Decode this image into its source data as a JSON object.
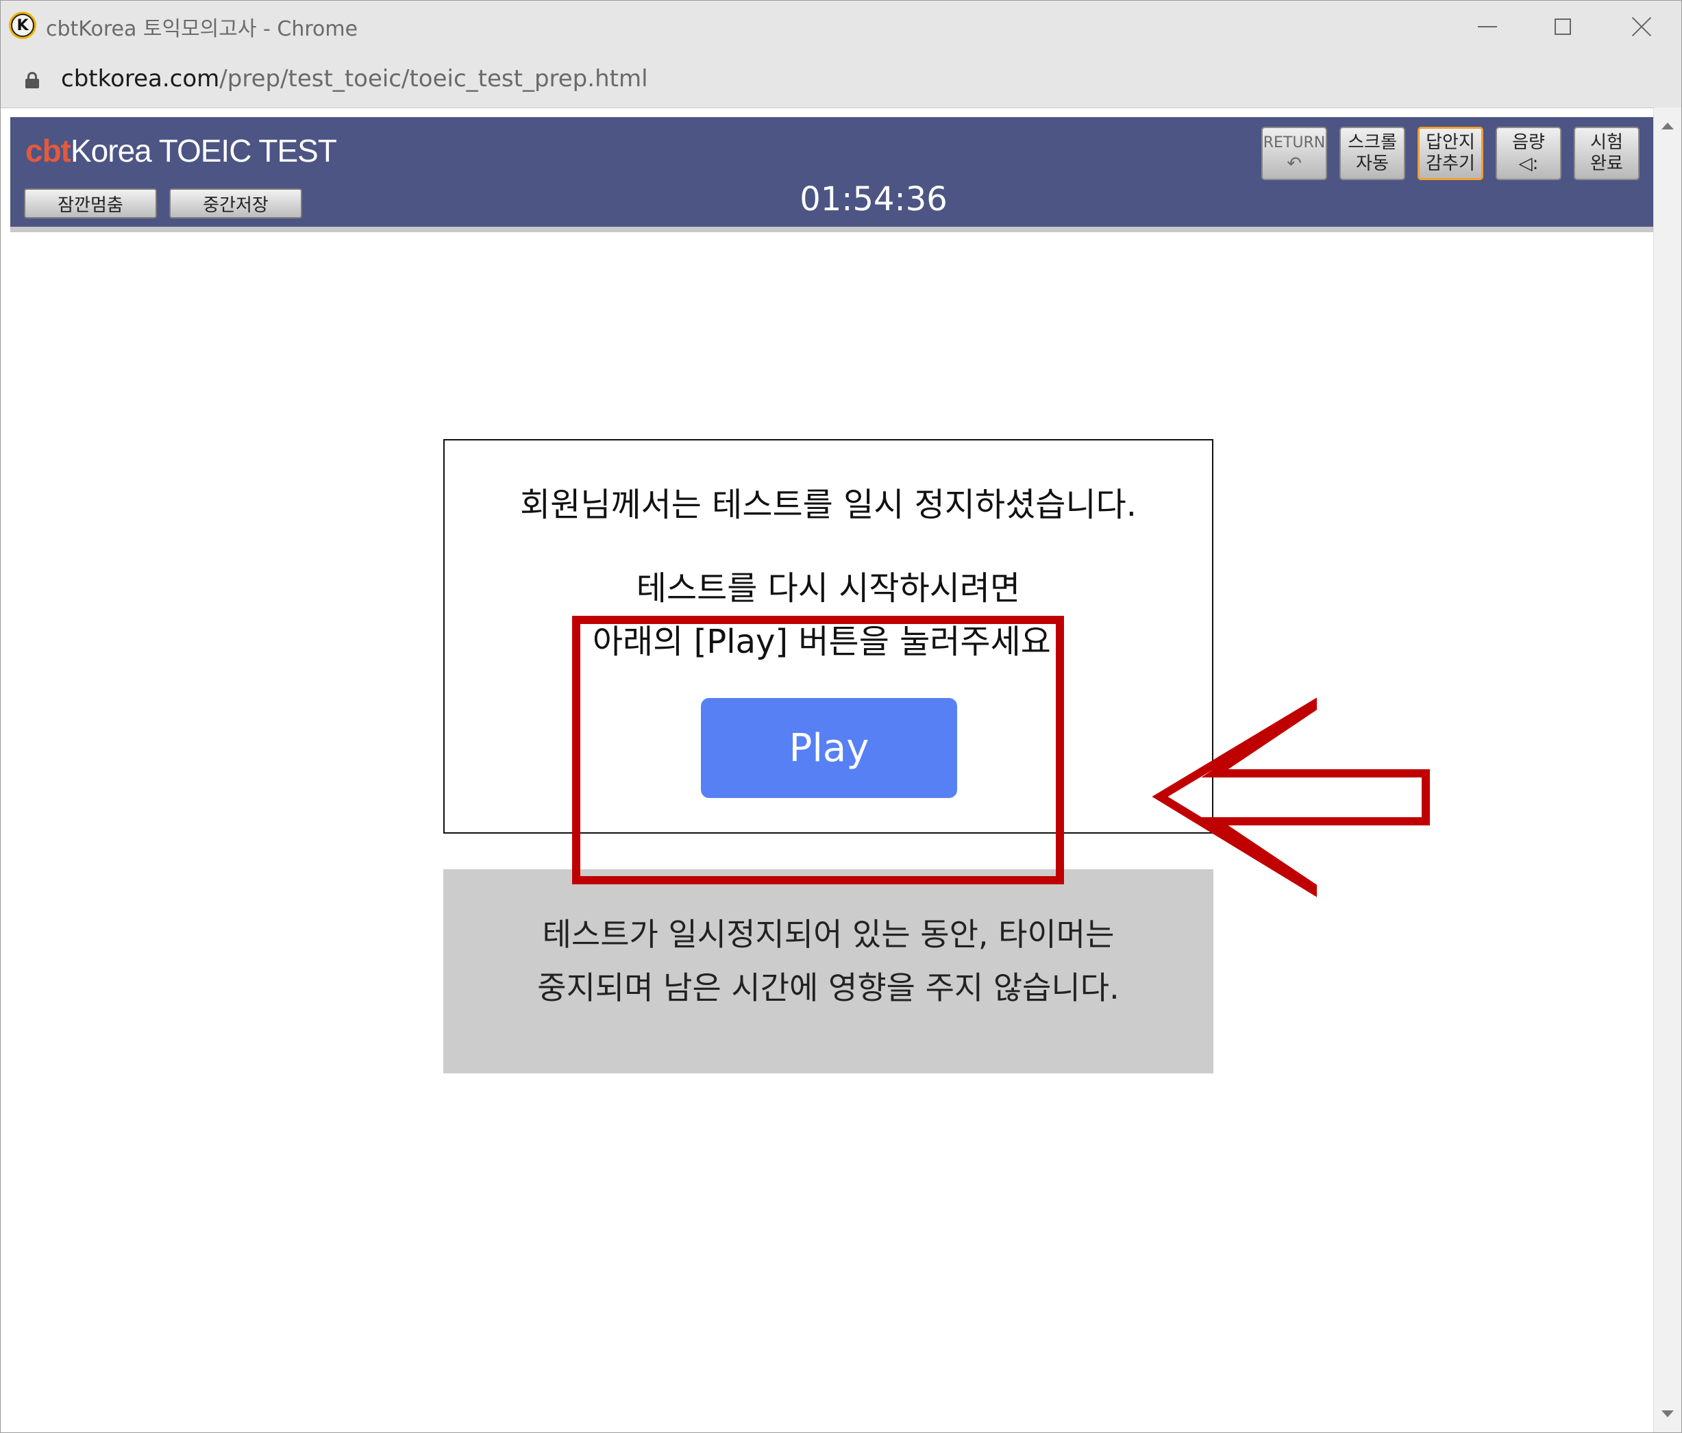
{
  "window": {
    "title": "cbtKorea 토익모의고사 - Chrome",
    "app_icon_letter": "K"
  },
  "address": {
    "host": "cbtkorea.com",
    "path": "/prep/test_toeic/toeic_test_prep.html"
  },
  "header": {
    "logo_cbt": "cbt",
    "logo_korea": "Korea",
    "logo_rest": " TOEIC TEST",
    "pause_label": "잠깐멈춤",
    "save_label": "중간저장",
    "timer": "01:54:36",
    "tools": {
      "return_line1": "RETURN",
      "return_line2": "↶",
      "scroll_line1": "스크롤",
      "scroll_line2": "자동",
      "answer_line1": "답안지",
      "answer_line2": "감추기",
      "volume_line1": "음량",
      "volume_line2": "◁:",
      "finish_line1": "시험",
      "finish_line2": "완료"
    }
  },
  "dialog": {
    "line1": "회원님께서는 테스트를 일시 정지하셨습니다.",
    "line2": "테스트를 다시 시작하시려면",
    "line3": "아래의 [Play] 버튼을 눌러주세요!",
    "play_label": "Play"
  },
  "info": {
    "line1": "테스트가 일시정지되어 있는 동안, 타이머는",
    "line2": "중지되며 남은 시간에 영향을 주지 않습니다."
  },
  "colors": {
    "header_bg": "#4c5583",
    "play_bg": "#5680f4",
    "annotation": "#c00000",
    "info_bg": "#cccccc"
  }
}
